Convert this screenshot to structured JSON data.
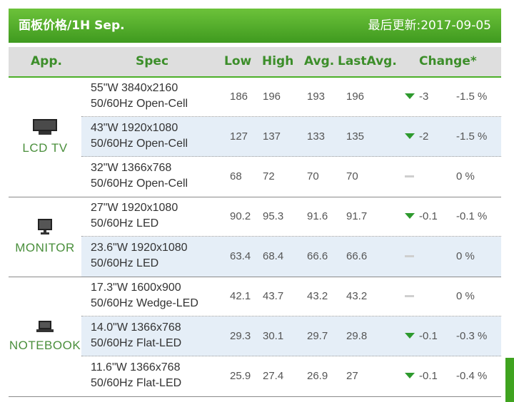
{
  "header": {
    "title": "面板价格/1H Sep.",
    "updated": "最后更新:2017-09-05"
  },
  "columns": {
    "app": "App.",
    "spec": "Spec",
    "low": "Low",
    "high": "High",
    "avg": "Avg.",
    "lastavg": "LastAvg.",
    "change": "Change*"
  },
  "groups": [
    {
      "label": "LCD TV",
      "icon": "tv-icon",
      "rows": [
        {
          "spec1": "55\"W 3840x2160",
          "spec2": "50/60Hz Open-Cell",
          "low": "186",
          "high": "196",
          "avg": "193",
          "lastavg": "196",
          "dir": "down",
          "change": "-3",
          "pct": "-1.5 %"
        },
        {
          "spec1": "43\"W 1920x1080",
          "spec2": "50/60Hz Open-Cell",
          "low": "127",
          "high": "137",
          "avg": "133",
          "lastavg": "135",
          "dir": "down",
          "change": "-2",
          "pct": "-1.5 %"
        },
        {
          "spec1": "32\"W 1366x768",
          "spec2": "50/60Hz Open-Cell",
          "low": "68",
          "high": "72",
          "avg": "70",
          "lastavg": "70",
          "dir": "flat",
          "change": "",
          "pct": "0 %"
        }
      ]
    },
    {
      "label": "MONITOR",
      "icon": "monitor-icon",
      "rows": [
        {
          "spec1": "27\"W 1920x1080",
          "spec2": "50/60Hz LED",
          "low": "90.2",
          "high": "95.3",
          "avg": "91.6",
          "lastavg": "91.7",
          "dir": "down",
          "change": "-0.1",
          "pct": "-0.1 %"
        },
        {
          "spec1": "23.6\"W 1920x1080",
          "spec2": "50/60Hz LED",
          "low": "63.4",
          "high": "68.4",
          "avg": "66.6",
          "lastavg": "66.6",
          "dir": "flat",
          "change": "",
          "pct": "0 %"
        }
      ]
    },
    {
      "label": "NOTEBOOK",
      "icon": "laptop-icon",
      "rows": [
        {
          "spec1": "17.3\"W 1600x900",
          "spec2": "50/60Hz Wedge-LED",
          "low": "42.1",
          "high": "43.7",
          "avg": "43.2",
          "lastavg": "43.2",
          "dir": "flat",
          "change": "",
          "pct": "0 %"
        },
        {
          "spec1": "14.0\"W 1366x768",
          "spec2": "50/60Hz Flat-LED",
          "low": "29.3",
          "high": "30.1",
          "avg": "29.7",
          "lastavg": "29.8",
          "dir": "down",
          "change": "-0.1",
          "pct": "-0.3 %"
        },
        {
          "spec1": "11.6\"W 1366x768",
          "spec2": "50/60Hz Flat-LED",
          "low": "25.9",
          "high": "27.4",
          "avg": "26.9",
          "lastavg": "27",
          "dir": "down",
          "change": "-0.1",
          "pct": "-0.4 %"
        }
      ]
    }
  ]
}
